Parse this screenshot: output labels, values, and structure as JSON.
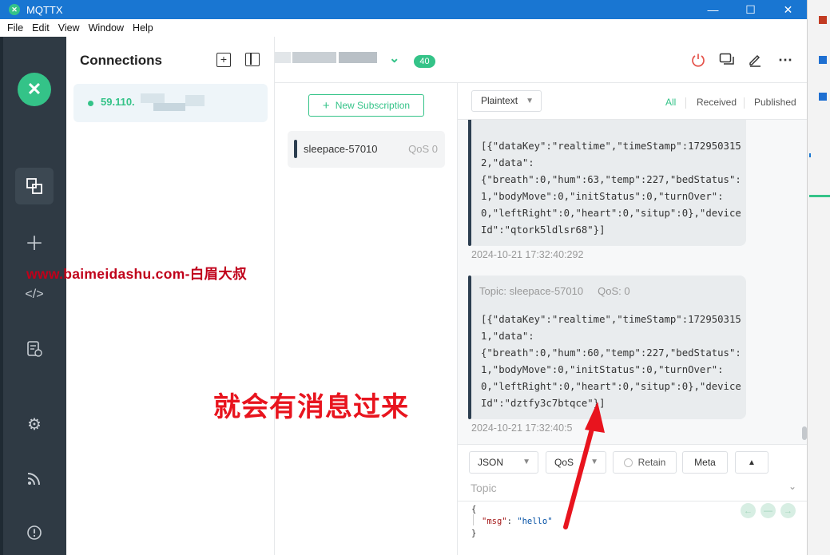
{
  "window": {
    "title": "MQTTX",
    "minimize": "—",
    "maximize": "☐",
    "close": "✕"
  },
  "menu": [
    "File",
    "Edit",
    "View",
    "Window",
    "Help"
  ],
  "connections": {
    "title": "Connections",
    "items": [
      {
        "name": "59.110.",
        "status": "connected"
      }
    ]
  },
  "header": {
    "badge": "40"
  },
  "subscriptions": {
    "new_label": "New Subscription",
    "items": [
      {
        "topic": "sleepace-57010",
        "qos": "QoS 0"
      }
    ]
  },
  "messages": {
    "format": "Plaintext",
    "tabs": [
      "All",
      "Received",
      "Published"
    ],
    "active_tab": "All",
    "items": [
      {
        "meta": "",
        "payload": "[{\"dataKey\":\"realtime\",\"timeStamp\":1729503152,\"data\":\n{\"breath\":0,\"hum\":63,\"temp\":227,\"bedStatus\":1,\"bodyMove\":0,\"initStatus\":0,\"turnOver\":0,\"leftRight\":0,\"heart\":0,\"situp\":0},\"deviceId\":\"qtork5ldlsr68\"}]",
        "time": "2024-10-21 17:32:40:292"
      },
      {
        "meta": "Topic: sleepace-57010     QoS: 0",
        "payload": "[{\"dataKey\":\"realtime\",\"timeStamp\":1729503151,\"data\":\n{\"breath\":0,\"hum\":60,\"temp\":227,\"bedStatus\":1,\"bodyMove\":0,\"initStatus\":0,\"turnOver\":0,\"leftRight\":0,\"heart\":0,\"situp\":0},\"deviceId\":\"dztfy3c7btqce\"}]",
        "time": "2024-10-21 17:32:40:5"
      }
    ]
  },
  "publish": {
    "format": "JSON",
    "qos": "QoS",
    "retain_label": "Retain",
    "meta_label": "Meta",
    "topic_placeholder": "Topic",
    "payload_open": "{",
    "payload_key": "\"msg\"",
    "payload_value": "\"hello\"",
    "payload_close": "}"
  },
  "overlays": {
    "watermark": "www.baimeidashu.com-白眉大叔",
    "annotation": "就会有消息过来"
  },
  "colors": {
    "accent": "#34c388",
    "titlebar": "#1976d2",
    "sidebar": "#2f3a44",
    "annotation": "#e8141e"
  }
}
